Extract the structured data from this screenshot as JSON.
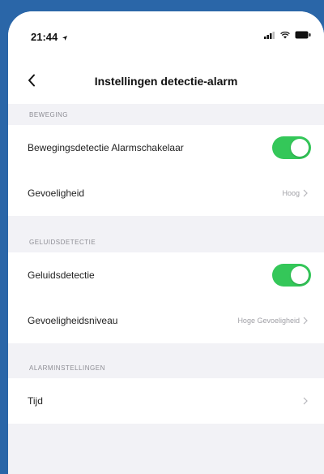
{
  "status": {
    "time": "21:44",
    "location_icon": "arrow-icon"
  },
  "nav": {
    "title": "Instellingen detectie-alarm"
  },
  "sections": {
    "motion": {
      "header": "BEWEGING",
      "toggle_label": "Bewegingsdetectie Alarmschakelaar",
      "toggle_on": true,
      "sensitivity_label": "Gevoeligheid",
      "sensitivity_value": "Hoog"
    },
    "sound": {
      "header": "GELUIDSDETECTIE",
      "toggle_label": "Geluidsdetectie",
      "toggle_on": true,
      "level_label": "Gevoeligheidsniveau",
      "level_value": "Hoge Gevoeligheid"
    },
    "alarm": {
      "header": "ALARMINSTELLINGEN",
      "time_label": "Tijd"
    }
  },
  "colors": {
    "background": "#2a66a8",
    "toggle_on": "#34c759",
    "screen": "#f2f2f6"
  }
}
